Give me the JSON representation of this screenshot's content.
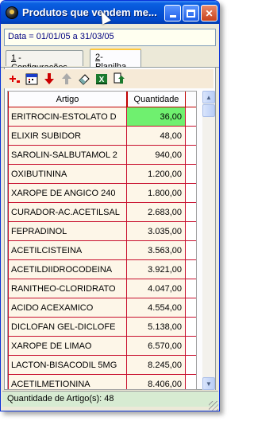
{
  "window": {
    "title": "Produtos que vendem me...",
    "date_range": "Data = 01/01/05 a 31/03/05"
  },
  "tabs": [
    {
      "key": "1",
      "label": " - Configurações"
    },
    {
      "key": "2",
      "label": "- Planilha"
    }
  ],
  "toolbar": {
    "icons": [
      "add-red-icon",
      "calendar-icon",
      "arrow-down-red-icon",
      "arrow-up-gray-icon",
      "eraser-icon",
      "excel-icon",
      "export-icon"
    ]
  },
  "grid": {
    "headers": [
      "Artigo",
      "Quantidade"
    ],
    "rows": [
      {
        "artigo": "ERITROCIN-ESTOLATO D",
        "quantidade": "36,00"
      },
      {
        "artigo": "ELIXIR SUBIDOR",
        "quantidade": "48,00"
      },
      {
        "artigo": "SAROLIN-SALBUTAMOL 2",
        "quantidade": "940,00"
      },
      {
        "artigo": "OXIBUTININA",
        "quantidade": "1.200,00"
      },
      {
        "artigo": "XAROPE DE ANGICO 240",
        "quantidade": "1.800,00"
      },
      {
        "artigo": "CURADOR-AC.ACETILSAL",
        "quantidade": "2.683,00"
      },
      {
        "artigo": "FEPRADINOL",
        "quantidade": "3.035,00"
      },
      {
        "artigo": "ACETILCISTEINA",
        "quantidade": "3.563,00"
      },
      {
        "artigo": "ACETILDIIDROCODEINA",
        "quantidade": "3.921,00"
      },
      {
        "artigo": "RANITHEO-CLORIDRATO",
        "quantidade": "4.047,00"
      },
      {
        "artigo": "ACIDO ACEXAMICO",
        "quantidade": "4.554,00"
      },
      {
        "artigo": "DICLOFAN GEL-DICLOFE",
        "quantidade": "5.138,00"
      },
      {
        "artigo": "XAROPE DE LIMAO",
        "quantidade": "6.570,00"
      },
      {
        "artigo": "LACTON-BISACODIL 5MG",
        "quantidade": "8.245,00"
      },
      {
        "artigo": "ACETILMETIONINA",
        "quantidade": "8.406,00"
      }
    ]
  },
  "status": {
    "text": "Quantidade de Artigo(s): 48"
  },
  "colors": {
    "selected_cell": "#6ff06f",
    "grid_line": "#c8102e",
    "row_bg": "#fdf6e8",
    "status_bg": "#d7ebd2"
  }
}
